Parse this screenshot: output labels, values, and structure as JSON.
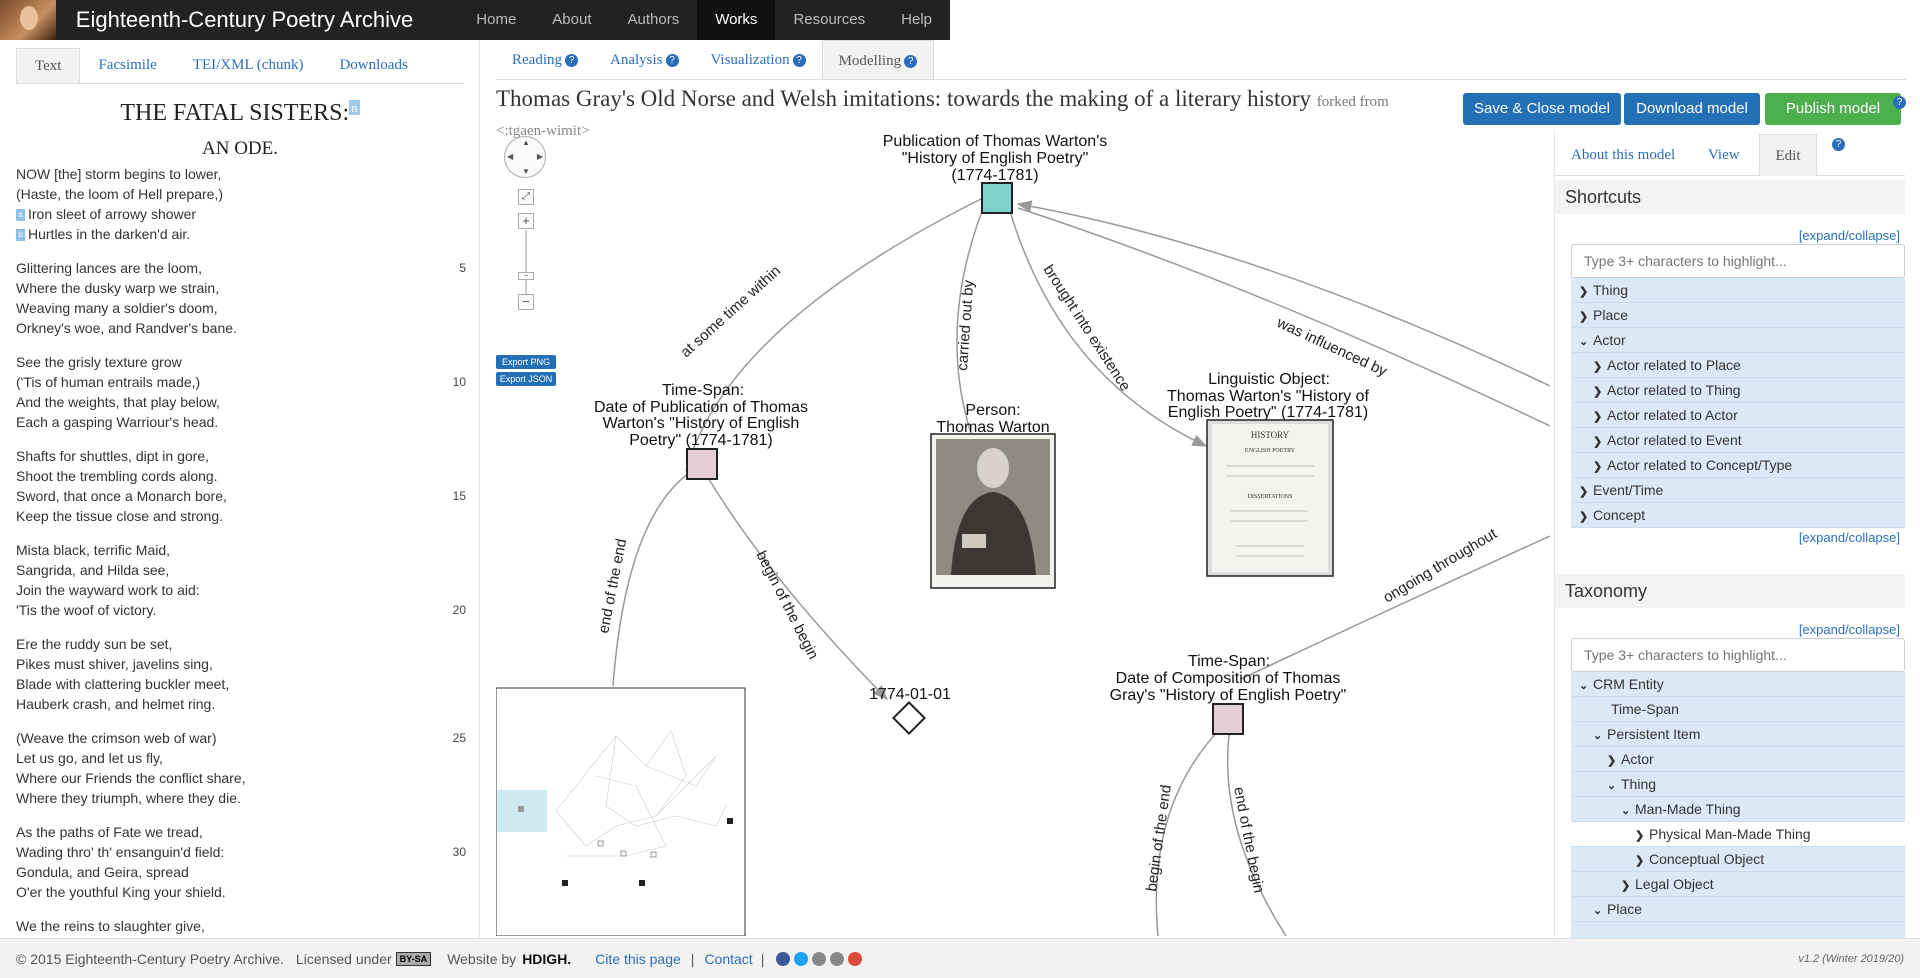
{
  "topnav": {
    "title": "Eighteenth-Century Poetry Archive",
    "items": [
      "Home",
      "About",
      "Authors",
      "Works",
      "Resources",
      "Help"
    ]
  },
  "lefttabs": [
    "Text",
    "Facsimile",
    "TEI/XML (chunk)",
    "Downloads"
  ],
  "poem": {
    "title": "THE FATAL SISTERS:",
    "title_note": "n",
    "subtitle": "AN ODE.",
    "marker_a": "a",
    "marker_b": "b",
    "lines": [
      "NOW [the] storm begins to lower,",
      "(Haste, the loom of Hell prepare,)",
      "Iron sleet of arrowy shower",
      "Hurtles in the darken'd air.",
      "Glittering lances are the loom,",
      "Where the dusky warp we strain,",
      "Weaving many a soldier's doom,",
      "Orkney's woe, and Randver's bane.",
      "See the grisly texture grow",
      "('Tis of human entrails made,)",
      "And the weights, that play below,",
      "Each a gasping Warriour's head.",
      "Shafts for shuttles, dipt in gore,",
      "Shoot the trembling cords along.",
      "Sword, that once a Monarch bore,",
      "Keep the tissue close and strong.",
      "Mista black, terrific Maid,",
      "Sangrida, and Hilda see,",
      "Join the wayward work to aid:",
      "'Tis the woof of victory.",
      "Ere the ruddy sun be set,",
      "Pikes must shiver, javelins sing,",
      "Blade with clattering buckler meet,",
      "Hauberk crash, and helmet ring.",
      "(Weave the crimson web of war)",
      "Let us go, and let us fly,",
      "Where our Friends the conflict share,",
      "Where they triumph, where they die.",
      "As the paths of Fate we tread,",
      "Wading thro' th' ensanguin'd field:",
      "Gondula, and Geira, spread",
      "O'er the youthful King your shield.",
      "We the reins to slaughter give,"
    ],
    "line_numbers": {
      "n5": "5",
      "n10": "10",
      "n15": "15",
      "n20": "20",
      "n25": "25",
      "n30": "30"
    }
  },
  "righttabs": [
    "Reading",
    "Analysis",
    "Visualization",
    "Modelling"
  ],
  "model": {
    "title": "Thomas Gray's Old Norse and Welsh imitations: towards the making of a literary history",
    "forked": "forked from",
    "curie": "<:tgaen-wimit>",
    "buttons": {
      "save": "Save & Close model",
      "download": "Download model",
      "publish": "Publish model"
    },
    "colors": {
      "save": "#2370b6",
      "download": "#2370b6",
      "publish": "#4cae4c"
    }
  },
  "graph": {
    "export_png": "Export PNG",
    "export_json": "Export JSON",
    "nodes": {
      "pub": [
        "Publication of Thomas Warton's",
        "\"History of English Poetry\"",
        "(1774-1781)"
      ],
      "ts1": [
        "Time-Span:",
        "Date of Publication of Thomas",
        "Warton's \"History of English",
        "Poetry\" (1774-1781)"
      ],
      "person": [
        "Person:",
        "Thomas Warton"
      ],
      "ling": [
        "Linguistic Object:",
        "Thomas Warton's \"History of",
        "English Poetry\" (1774-1781)"
      ],
      "date": "1774-01-01",
      "ts2": [
        "Time-Span:",
        "Date of Composition of Thomas",
        "Gray's \"History of English Poetry\""
      ]
    },
    "edges": {
      "e1": "at some time within",
      "e2": "carried out by",
      "e3": "brought into existence",
      "e4": "was influenced by",
      "e5": "end of the end",
      "e6": "begin of the begin",
      "e7": "ongoing throughout",
      "e8": "begin of the end",
      "e9": "end of the begin"
    },
    "book": {
      "heading": "HISTORY",
      "line2": "ENGLISH POETRY",
      "line3": "DISSERTATIONS"
    }
  },
  "side": {
    "tabs": [
      "About this model",
      "View",
      "Edit"
    ],
    "shortcuts_title": "Shortcuts",
    "taxonomy_title": "Taxonomy",
    "expand": "[expand/collapse]",
    "search_placeholder": "Type 3+ characters to highlight...",
    "shortcuts": [
      "Thing",
      "Place",
      "Actor",
      "Actor related to Place",
      "Actor related to Thing",
      "Actor related to Actor",
      "Actor related to Event",
      "Actor related to Concept/Type",
      "Event/Time",
      "Concept"
    ],
    "taxonomy": [
      "CRM Entity",
      "Time-Span",
      "Persistent Item",
      "Actor",
      "Thing",
      "Man-Made Thing",
      "Physical Man-Made Thing",
      "Conceptual Object",
      "Legal Object",
      "Place"
    ]
  },
  "footer": {
    "copyright": "© 2015 Eighteenth-Century Poetry Archive.",
    "licensed": "Licensed under",
    "license": "BY-SA",
    "website_by": "Website by",
    "maker": "HDIGH.",
    "cite": "Cite this page",
    "sep": "|",
    "contact": "Contact",
    "version": "v1.2 (Winter 2019/20)"
  }
}
